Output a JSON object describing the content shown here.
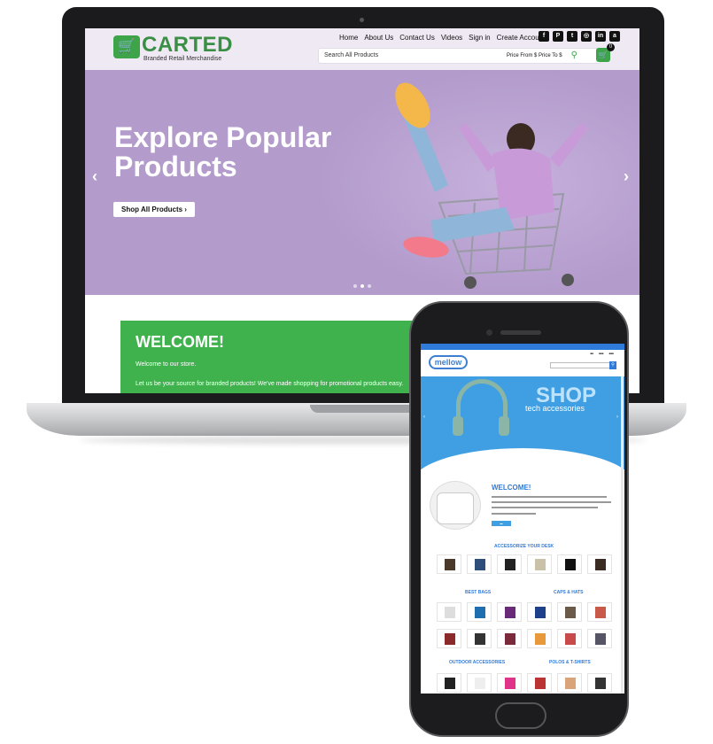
{
  "desktop": {
    "logo": {
      "name": "CARTED",
      "tagline": "Branded Retail Merchandise"
    },
    "nav": [
      "Home",
      "About Us",
      "Contact Us",
      "Videos",
      "Sign in",
      "Create Account"
    ],
    "social_icons": [
      "facebook-icon",
      "pinterest-icon",
      "twitter-icon",
      "instagram-icon",
      "linkedin-icon",
      "amazon-icon"
    ],
    "search": {
      "placeholder": "Search All Products",
      "price_from": "Price From $",
      "price_to": "Price To $"
    },
    "cart": {
      "count": "0"
    },
    "hero": {
      "title": "Explore Popular Products",
      "button": "Shop All Products ›",
      "slides": 3,
      "active_slide": 2
    },
    "welcome": {
      "title": "WELCOME!",
      "subtitle": "Welcome to our store.",
      "body": "Let us be your source for branded products! We've made shopping for promotional products easy."
    },
    "colors": {
      "brand_green": "#3da44a",
      "hero_bg": "#b39ccc",
      "header_bg": "#efe9f4"
    }
  },
  "mobile": {
    "logo": {
      "name": "mellow"
    },
    "hero": {
      "title": "SHOP",
      "subtitle": "tech accessories"
    },
    "welcome": {
      "title": "WELCOME!"
    },
    "sections": [
      "ACCESSORIZE YOUR DESK",
      "BEST BAGS",
      "CAPS & HATS",
      "OUTDOOR ACCESSORIES",
      "POLOS & T-SHIRTS"
    ],
    "colors": {
      "brand_blue": "#2f7bd9",
      "hero_bg": "#3f9fe2"
    }
  }
}
